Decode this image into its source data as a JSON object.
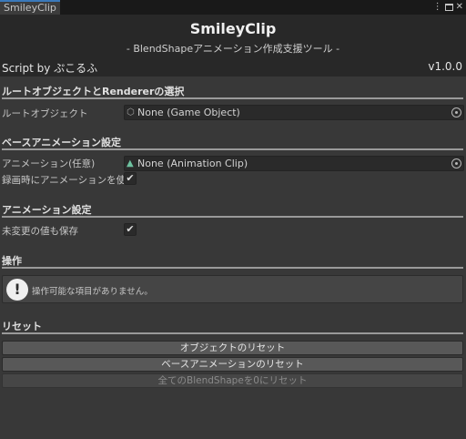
{
  "tab": {
    "title": "SmileyClip"
  },
  "window_controls": {
    "menu": "⋮",
    "close": "✕"
  },
  "header": {
    "title": "SmileyClip",
    "subtitle": "- BlendShapeアニメーション作成支援ツール -",
    "byline": "Script by ぷこるふ",
    "version": "v1.0.0"
  },
  "sections": {
    "root": {
      "heading": "ルートオブジェクトとRendererの選択",
      "root_label": "ルートオブジェクト",
      "root_value": "None (Game Object)"
    },
    "base_anim": {
      "heading": "ベースアニメーション設定",
      "anim_label": "アニメーション(任意)",
      "anim_value": "None (Animation Clip)",
      "record_label": "録画時にアニメーションを使用",
      "record_checked": true
    },
    "anim_settings": {
      "heading": "アニメーション設定",
      "save_unchanged_label": "未変更の値も保存",
      "save_unchanged_checked": true
    },
    "operations": {
      "heading": "操作",
      "help_text": "操作可能な項目がありません。"
    },
    "reset": {
      "heading": "リセット",
      "reset_object_label": "オブジェクトのリセット",
      "reset_base_anim_label": "ベースアニメーションのリセット",
      "reset_all_blendshape_label": "全てのBlendShapeを0にリセット",
      "reset_all_enabled": false
    }
  },
  "checkmark": "✔",
  "icons": {
    "info": "!",
    "gameobject": "cube-icon",
    "animclip": "animation-clip-icon"
  },
  "colors": {
    "background": "#383838",
    "header_bg": "#282828",
    "tab_accent": "#3a79bb"
  }
}
